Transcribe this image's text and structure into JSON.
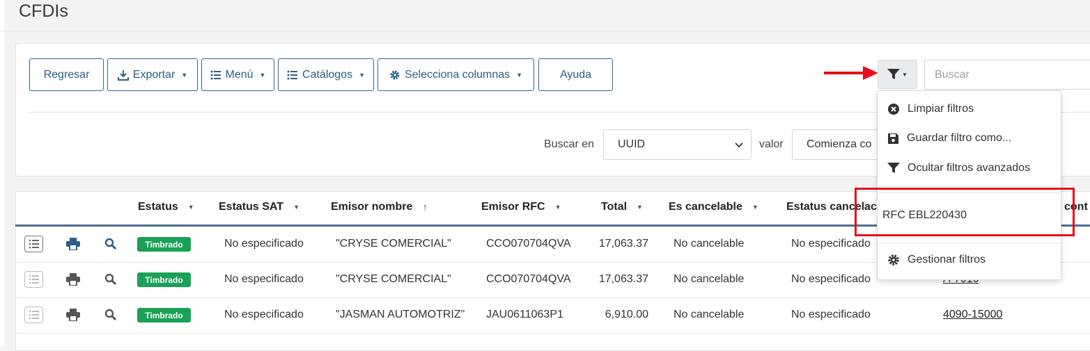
{
  "page": {
    "title": "CFDIs"
  },
  "toolbar": {
    "back_label": "Regresar",
    "export_label": "Exportar",
    "menu_label": "Menú",
    "catalogs_label": "Catálogos",
    "columns_label": "Selecciona columnas",
    "help_label": "Ayuda"
  },
  "search": {
    "placeholder": "Buscar"
  },
  "filter_row": {
    "search_in_label": "Buscar en",
    "search_in_value": "UUID",
    "value_label": "valor",
    "value_select": "Comienza co"
  },
  "filter_menu": {
    "clear": "Limpiar filtros",
    "save_as": "Guardar filtro como...",
    "hide_advanced": "Ocultar filtros avanzados",
    "saved_filter": "RFC EBL220430",
    "manage": "Gestionar filtros"
  },
  "table": {
    "headers": {
      "status": "Estatus",
      "sat_status": "Estatus SAT",
      "issuer_name": "Emisor nombre",
      "issuer_rfc": "Emisor RFC",
      "total": "Total",
      "cancellable": "Es cancelable",
      "cancel_status": "Estatus cancelac",
      "cont": "cont"
    },
    "rows": [
      {
        "status": "Timbrado",
        "sat_status": "No especificado",
        "issuer_name": "\"CRYSE COMERCIAL\"",
        "issuer_rfc": "CCO070704QVA",
        "total": "17,063.37",
        "cancellable": "No cancelable",
        "cancel_status": "No especificado",
        "account": ""
      },
      {
        "status": "Timbrado",
        "sat_status": "No especificado",
        "issuer_name": "\"CRYSE COMERCIAL\"",
        "issuer_rfc": "CCO070704QVA",
        "total": "17,063.37",
        "cancellable": "No cancelable",
        "cancel_status": "No especificado",
        "account": "A-7010"
      },
      {
        "status": "Timbrado",
        "sat_status": "No especificado",
        "issuer_name": "\"JASMAN AUTOMOTRIZ\"",
        "issuer_rfc": "JAU0611063P1",
        "total": "6,910.00",
        "cancellable": "No cancelable",
        "cancel_status": "No especificado",
        "account": "4090-15000"
      }
    ]
  },
  "colors": {
    "primary": "#2c5c87",
    "badge": "#1aa157",
    "highlight": "#e3101b",
    "arrow": "#e3101b"
  }
}
